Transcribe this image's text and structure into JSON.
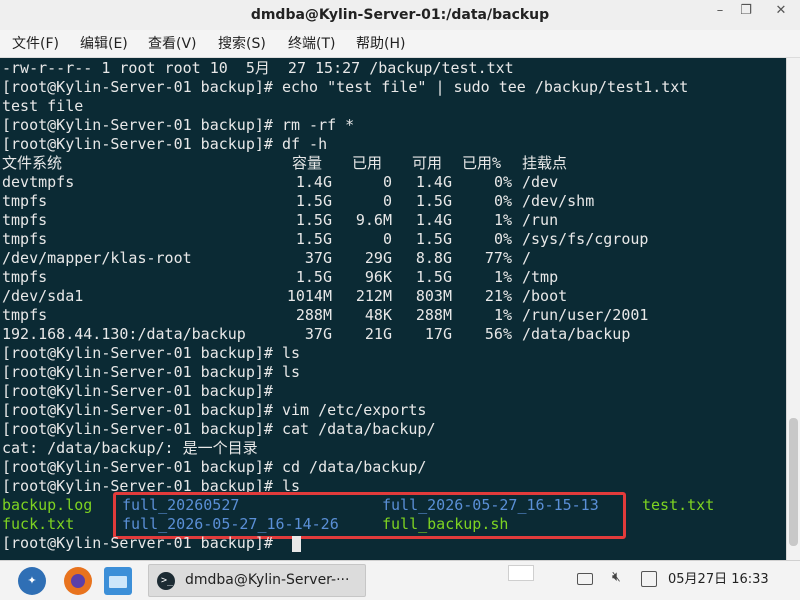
{
  "window": {
    "title": "dmdba@Kylin-Server-01:/data/backup",
    "minimize_glyph": "–",
    "maximize_glyph": "❐",
    "close_glyph": "✕"
  },
  "menu": {
    "items": [
      "文件(F)",
      "编辑(E)",
      "查看(V)",
      "搜索(S)",
      "终端(T)",
      "帮助(H)"
    ]
  },
  "terminal": {
    "lines_before_df": [
      "-rw-r--r-- 1 root root 10  5月  27 15:27 /backup/test.txt",
      "[root@Kylin-Server-01 backup]# echo \"test file\" | sudo tee /backup/test1.txt",
      "test file",
      "[root@Kylin-Server-01 backup]# rm -rf *",
      "[root@Kylin-Server-01 backup]# df -h"
    ],
    "df": {
      "headers": [
        "文件系统",
        "容量",
        "已用",
        "可用",
        "已用%",
        "挂载点"
      ],
      "rows": [
        [
          "devtmpfs",
          "1.4G",
          "0",
          "1.4G",
          "0%",
          "/dev"
        ],
        [
          "tmpfs",
          "1.5G",
          "0",
          "1.5G",
          "0%",
          "/dev/shm"
        ],
        [
          "tmpfs",
          "1.5G",
          "9.6M",
          "1.4G",
          "1%",
          "/run"
        ],
        [
          "tmpfs",
          "1.5G",
          "0",
          "1.5G",
          "0%",
          "/sys/fs/cgroup"
        ],
        [
          "/dev/mapper/klas-root",
          "37G",
          "29G",
          "8.8G",
          "77%",
          "/"
        ],
        [
          "tmpfs",
          "1.5G",
          "96K",
          "1.5G",
          "1%",
          "/tmp"
        ],
        [
          "/dev/sda1",
          "1014M",
          "212M",
          "803M",
          "21%",
          "/boot"
        ],
        [
          "tmpfs",
          "288M",
          "48K",
          "288M",
          "1%",
          "/run/user/2001"
        ],
        [
          "192.168.44.130:/data/backup",
          "37G",
          "21G",
          "17G",
          "56%",
          "/data/backup"
        ]
      ]
    },
    "lines_after_df": [
      "[root@Kylin-Server-01 backup]# ls",
      "[root@Kylin-Server-01 backup]# ls",
      "[root@Kylin-Server-01 backup]#",
      "[root@Kylin-Server-01 backup]# vim /etc/exports",
      "[root@Kylin-Server-01 backup]# cat /data/backup/",
      "cat: /data/backup/: 是一个目录",
      "[root@Kylin-Server-01 backup]# cd /data/backup/",
      "[root@Kylin-Server-01 backup]# ls"
    ],
    "ls_output": [
      {
        "name": "backup.log",
        "kind": "file",
        "col": 0,
        "row": 0
      },
      {
        "name": "full_20260527",
        "kind": "dir",
        "col": 1,
        "row": 0
      },
      {
        "name": "full_2026-05-27_16-15-13",
        "kind": "dir",
        "col": 2,
        "row": 0
      },
      {
        "name": "test.txt",
        "kind": "file",
        "col": 3,
        "row": 0
      },
      {
        "name": "fuck.txt",
        "kind": "file",
        "col": 0,
        "row": 1
      },
      {
        "name": "full_2026-05-27_16-14-26",
        "kind": "dir",
        "col": 1,
        "row": 1
      },
      {
        "name": "full_backup.sh",
        "kind": "file",
        "col": 2,
        "row": 1
      }
    ],
    "final_prompt": "[root@Kylin-Server-01 backup]#",
    "colors": {
      "background": "#0b2a34",
      "text": "#e8e8e8",
      "file": "#7ed321",
      "directory": "#5a8fd6",
      "highlight": "#e23b3b"
    }
  },
  "taskbar": {
    "task_label": "dmdba@Kylin-Server-···",
    "clock": "05月27日 16:33",
    "icons": [
      "start-menu-icon",
      "firefox-icon",
      "file-manager-icon",
      "terminal-icon",
      "keyboard-icon",
      "volume-muted-icon",
      "network-icon"
    ]
  }
}
